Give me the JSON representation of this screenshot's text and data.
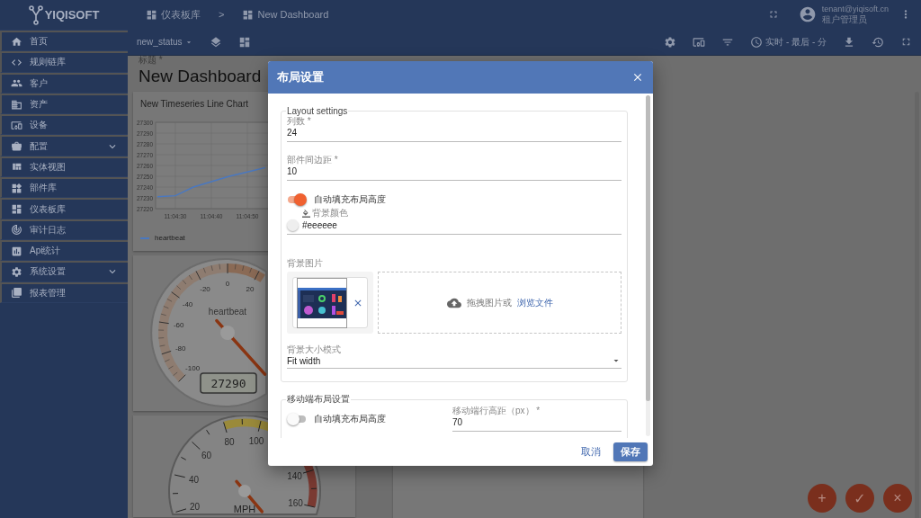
{
  "header": {
    "logo": "YIQISOFT",
    "breadcrumb": [
      {
        "label": "仪表板库"
      },
      {
        "label": "New Dashboard"
      }
    ],
    "separator": ">",
    "user": {
      "email": "tenant@yiqisoft.cn",
      "role": "租户管理员"
    }
  },
  "sidebar": {
    "items": [
      {
        "label": "首页",
        "expandable": false
      },
      {
        "label": "规则链库",
        "expandable": false
      },
      {
        "label": "客户",
        "expandable": false
      },
      {
        "label": "资产",
        "expandable": false
      },
      {
        "label": "设备",
        "expandable": false
      },
      {
        "label": "配置",
        "expandable": true
      },
      {
        "label": "实体视图",
        "expandable": false
      },
      {
        "label": "部件库",
        "expandable": false
      },
      {
        "label": "仪表板库",
        "expandable": false
      },
      {
        "label": "审计日志",
        "expandable": false
      },
      {
        "label": "Api统计",
        "expandable": false
      },
      {
        "label": "系统设置",
        "expandable": true
      },
      {
        "label": "报表管理",
        "expandable": false
      }
    ]
  },
  "toolbar": {
    "state_menu": "new_status",
    "timewindow": "实时 - 最后 - 分"
  },
  "dashboard": {
    "title_label": "标题 *",
    "title": "New Dashboard",
    "widgets": [
      {
        "kind": "line_chart",
        "title": "New Timeseries Line Chart",
        "chart_data": {
          "type": "line",
          "categories": [
            null,
            "11:04:30",
            null,
            "11:04:40",
            null,
            "11:04:50",
            null
          ],
          "ylim": [
            27220,
            27300
          ],
          "yticks": [
            27220,
            27230,
            27240,
            27250,
            27260,
            27270,
            27280,
            27290,
            27300
          ],
          "series": [
            {
              "name": "heartbeat",
              "color": "#4a78c0",
              "values": [
                27231,
                27232,
                27240,
                27245,
                27250,
                27254,
                27258
              ]
            }
          ]
        }
      },
      {
        "kind": "gauge",
        "label": "heartbeat",
        "reading": "27290",
        "tick_labels": [
          "-100",
          "-80",
          "-60",
          "-40",
          "-20",
          "0",
          "20"
        ]
      },
      {
        "kind": "speedometer",
        "unit": "MPH",
        "tick_labels": [
          "20",
          "40",
          "60",
          "80",
          "100",
          "140",
          "160"
        ]
      }
    ]
  },
  "dialog": {
    "title": "布局设置",
    "layout": {
      "legend": "Layout settings",
      "columns": {
        "label": "列数 *",
        "value": "24"
      },
      "margin": {
        "label": "部件间边距 *",
        "value": "10"
      },
      "autofill": {
        "label": "自动填充布局高度",
        "on": true
      },
      "background_color": {
        "label": "背景颜色",
        "value": "#eeeeee"
      },
      "background_image": {
        "label": "背景图片",
        "drop_text": "拖拽图片或",
        "browse": "浏览文件"
      },
      "size_mode": {
        "label": "背景大小模式",
        "value": "Fit width"
      }
    },
    "mobile": {
      "legend": "移动端布局设置",
      "autofill": {
        "label": "自动填充布局高度",
        "on": false
      },
      "row_height": {
        "label": "移动端行高距（px） *",
        "value": "70"
      }
    },
    "actions": {
      "cancel": "取消",
      "save": "保存"
    }
  },
  "fabs": [
    "+",
    "✓",
    "×"
  ]
}
